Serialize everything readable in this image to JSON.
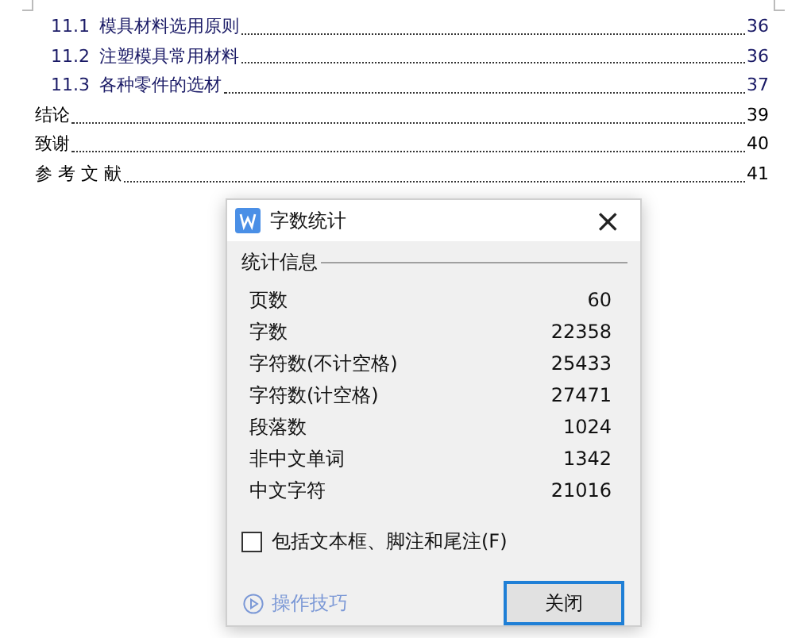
{
  "document": {
    "toc": [
      {
        "kind": "subsection",
        "number": "11.1",
        "title": "模具材料选用原则",
        "page": "36"
      },
      {
        "kind": "subsection",
        "number": "11.2",
        "title": "注塑模具常用材料",
        "page": "36"
      },
      {
        "kind": "subsection",
        "number": "11.3",
        "title": "各种零件的选材",
        "page": "37"
      },
      {
        "kind": "chapter",
        "title": "结论",
        "page": "39"
      },
      {
        "kind": "chapter",
        "title": "致谢",
        "page": "40"
      },
      {
        "kind": "chapter",
        "title": "参 考 文 献",
        "page": "41"
      }
    ]
  },
  "dialog": {
    "title": "字数统计",
    "close_icon": "×",
    "group": "统计信息",
    "stats": [
      {
        "label": "页数",
        "value": "60"
      },
      {
        "label": "字数",
        "value": "22358"
      },
      {
        "label": "字符数(不计空格)",
        "value": "25433"
      },
      {
        "label": "字符数(计空格)",
        "value": "27471"
      },
      {
        "label": "段落数",
        "value": "1024"
      },
      {
        "label": "非中文单词",
        "value": "1342"
      },
      {
        "label": "中文字符",
        "value": "21016"
      }
    ],
    "include_checkbox": {
      "label": "包括文本框、脚注和尾注(F)",
      "checked": false
    },
    "tips_link": "操作技巧",
    "close_button": "关闭"
  }
}
